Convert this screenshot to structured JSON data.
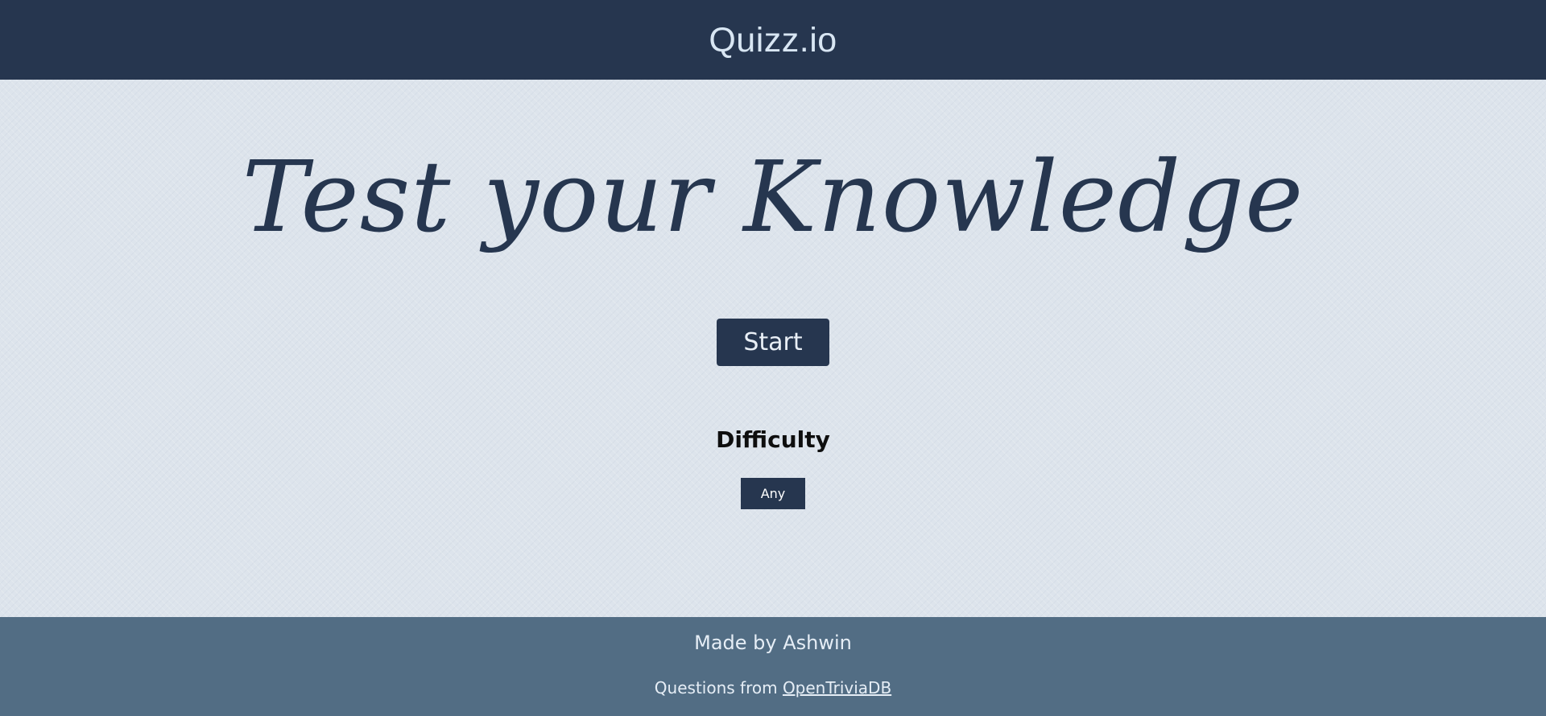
{
  "header": {
    "title": "Quizz.io"
  },
  "hero": {
    "headline": "Test your Knowledge",
    "start_label": "Start"
  },
  "difficulty": {
    "label": "Difficulty",
    "selected": "Any"
  },
  "footer": {
    "made_by": "Made by Ashwin",
    "questions_prefix": "Questions from",
    "source_link": "OpenTriviaDB"
  },
  "colors": {
    "header_bg": "#26364f",
    "main_bg": "#dde4ec",
    "footer_bg": "#526d84",
    "accent": "#26364f"
  }
}
